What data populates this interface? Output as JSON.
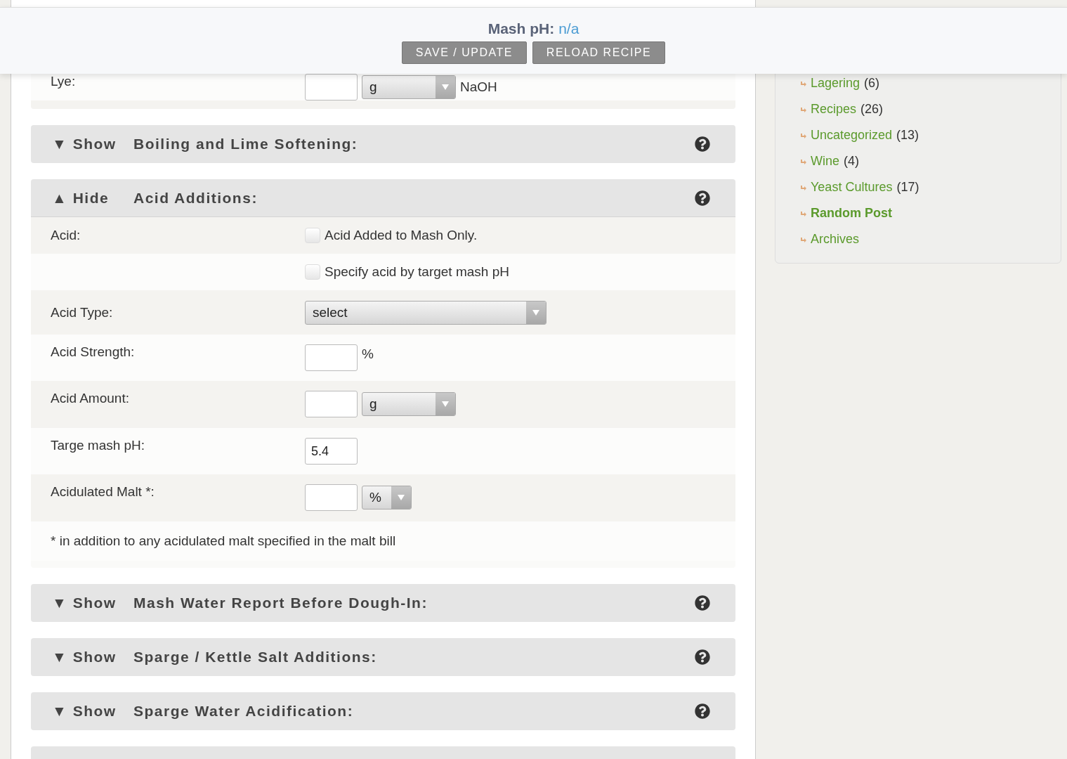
{
  "header": {
    "label": "Mash pH:",
    "value": "n/a",
    "buttons": [
      "SAVE / UPDATE",
      "RELOAD RECIPE"
    ]
  },
  "lye_row": {
    "label": "Lye:",
    "unit": "g",
    "suffix": "NaOH"
  },
  "sections": [
    {
      "toggle": "▼",
      "action": "Show",
      "title": "Boiling and Lime Softening:",
      "expanded": false
    },
    {
      "toggle": "▲",
      "action": "Hide",
      "title": "Acid Additions:",
      "expanded": true,
      "rows": [
        {
          "kind": "checkbox",
          "label": "Acid:",
          "text": "Acid Added to Mash Only.",
          "checked": false
        },
        {
          "kind": "checkbox",
          "text": "Specify acid by target mash pH",
          "checked": false
        },
        {
          "kind": "select",
          "label": "Acid Type:",
          "option": "select"
        },
        {
          "kind": "input",
          "label": "Acid Strength:",
          "unit": "%"
        },
        {
          "kind": "input_select",
          "label": "Acid Amount:",
          "option": "g"
        },
        {
          "kind": "input",
          "label": "Targe mash pH:",
          "value": "5.4"
        },
        {
          "kind": "input_select",
          "label": "Acidulated Malt *:",
          "option": "%"
        },
        {
          "kind": "note",
          "text": "* in addition to any acidulated malt specified in the malt bill"
        }
      ]
    },
    {
      "toggle": "▼",
      "action": "Show",
      "title": "Mash Water Report Before Dough-In:",
      "expanded": false
    },
    {
      "toggle": "▼",
      "action": "Show",
      "title": "Sparge / Kettle Salt Additions:",
      "expanded": false
    },
    {
      "toggle": "▼",
      "action": "Show",
      "title": "Sparge Water Acidification:",
      "expanded": false
    },
    {
      "expanded": false
    }
  ],
  "sidebar": {
    "items": [
      {
        "label": "Lagering",
        "count": "(6)",
        "bold": false
      },
      {
        "label": "Recipes",
        "count": "(26)",
        "bold": false
      },
      {
        "label": "Uncategorized",
        "count": "(13)",
        "bold": false
      },
      {
        "label": "Wine",
        "count": "(4)",
        "bold": false
      },
      {
        "label": "Yeast Cultures",
        "count": "(17)",
        "bold": false
      },
      {
        "label": "Random Post",
        "bold": true
      },
      {
        "label": "Archives",
        "bold": false
      }
    ]
  }
}
